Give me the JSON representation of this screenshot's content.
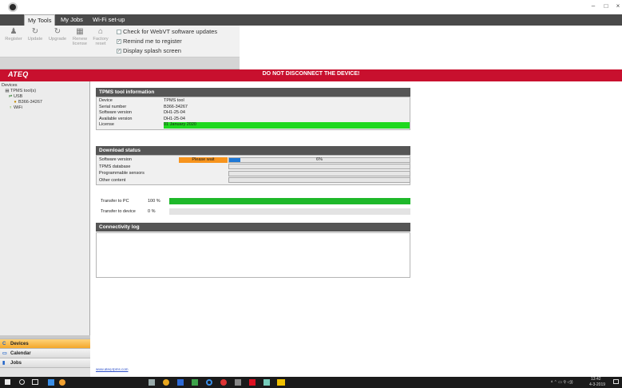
{
  "window": {
    "minimize_glyph": "–",
    "maximize_glyph": "□",
    "close_glyph": "×"
  },
  "ribbon": {
    "tabs": [
      "My Tools",
      "My Jobs",
      "Wi-Fi set-up"
    ],
    "buttons": [
      {
        "label": "Register",
        "icon": "user-icon",
        "glyph": "♟"
      },
      {
        "label": "Update",
        "icon": "refresh-icon",
        "glyph": "↻"
      },
      {
        "label": "Upgrade",
        "icon": "upgrade-icon",
        "glyph": "↻"
      },
      {
        "label": "Renew",
        "label2": "license",
        "icon": "calendar-icon",
        "glyph": "▦"
      },
      {
        "label": "Factory",
        "label2": "reset",
        "icon": "home-icon",
        "glyph": "⌂"
      }
    ],
    "checkboxes": [
      {
        "label": "Check for WebVT software updates",
        "checked": false
      },
      {
        "label": "Remind me to register",
        "checked": true
      },
      {
        "label": "Display splash screen",
        "checked": true
      }
    ]
  },
  "banner": {
    "logo": "ATEQ",
    "message": "DO NOT DISCONNECT THE DEVICE!"
  },
  "sidebar": {
    "tree": [
      {
        "label": "Devices",
        "level": 0,
        "icon": ""
      },
      {
        "label": "TPMS tool(s)",
        "level": 1,
        "icon": "device-icon"
      },
      {
        "label": "USB",
        "level": 2,
        "icon": "usb-icon"
      },
      {
        "label": "B366-34267",
        "level": 3,
        "icon": "tool-icon"
      },
      {
        "label": "WiFi",
        "level": 2,
        "icon": "wifi-icon"
      }
    ],
    "nav": [
      {
        "label": "Devices",
        "active": true,
        "icon": "devices-icon"
      },
      {
        "label": "Calendar",
        "active": false,
        "icon": "calendar-icon"
      },
      {
        "label": "Jobs",
        "active": false,
        "icon": "jobs-icon"
      }
    ]
  },
  "tool_info": {
    "title": "TPMS tool information",
    "rows": [
      {
        "key": "Device",
        "value": "TPMS tool"
      },
      {
        "key": "Serial number",
        "value": "B366-34267"
      },
      {
        "key": "Software version",
        "value": "DH1-25-04"
      },
      {
        "key": "Available version",
        "value": "DH1-25-04"
      },
      {
        "key": "License",
        "value": "01 January 2020"
      }
    ]
  },
  "download": {
    "title": "Download status",
    "rows": [
      {
        "key": "Software version",
        "status": "Please wait",
        "progress_percent": 6,
        "progress_text": "6%"
      },
      {
        "key": "TPMS database"
      },
      {
        "key": "Programmable sensors"
      },
      {
        "key": "Other content"
      }
    ]
  },
  "transfer": [
    {
      "label": "Transfer to PC",
      "percent_text": "100 %",
      "progress_percent": 100
    },
    {
      "label": "Transfer to device",
      "percent_text": "0 %",
      "progress_percent": 0
    }
  ],
  "connectivity": {
    "title": "Connectivity log"
  },
  "footer": {
    "website": "www.ateq-tpms.com"
  },
  "taskbar": {
    "time": "13:42",
    "date": "4-3-2019",
    "colors": {
      "bg": "#1b1b1b",
      "banner": "#c8102e"
    }
  }
}
